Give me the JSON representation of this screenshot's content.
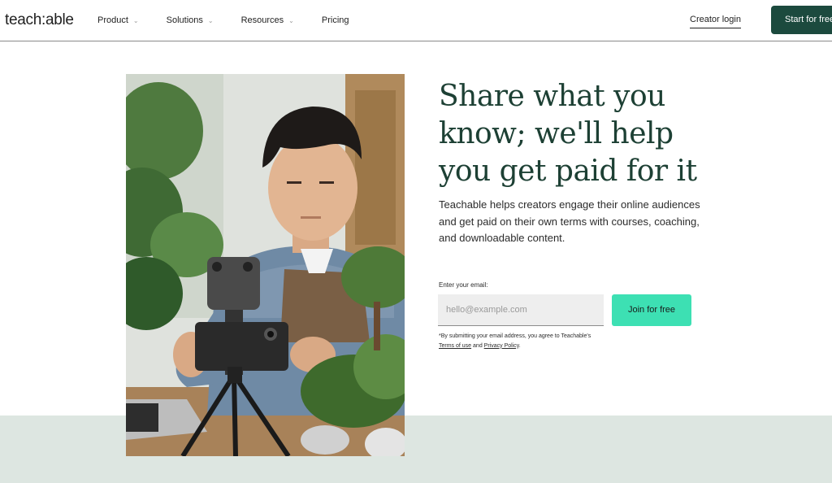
{
  "header": {
    "logo": "teach:able",
    "nav": [
      {
        "label": "Product",
        "has_dropdown": true
      },
      {
        "label": "Solutions",
        "has_dropdown": true
      },
      {
        "label": "Resources",
        "has_dropdown": true
      },
      {
        "label": "Pricing",
        "has_dropdown": false
      }
    ],
    "login_label": "Creator login",
    "cta_label": "Start for free"
  },
  "hero": {
    "headline": "Share what you know; we'll help you get paid for it",
    "subtext": "Teachable helps creators engage their online audiences and get paid on their own terms with courses, coaching, and downloadable content.",
    "email_label": "Enter your email:",
    "email_placeholder": "hello@example.com",
    "email_value": "",
    "join_label": "Join for free",
    "disclaimer_prefix": "*By submitting your email address, you agree to Teachable's",
    "terms_label": "Terms of use",
    "disclaimer_and": "and",
    "privacy_label": "Privacy Policy",
    "disclaimer_suffix": "."
  },
  "colors": {
    "brand_dark_green": "#1c4a3e",
    "headline_green": "#1d4034",
    "cta_mint": "#3de0b3",
    "band_bg": "#dde6e1"
  },
  "icons": {
    "nav_dropdown": "chevron-down-icon"
  }
}
